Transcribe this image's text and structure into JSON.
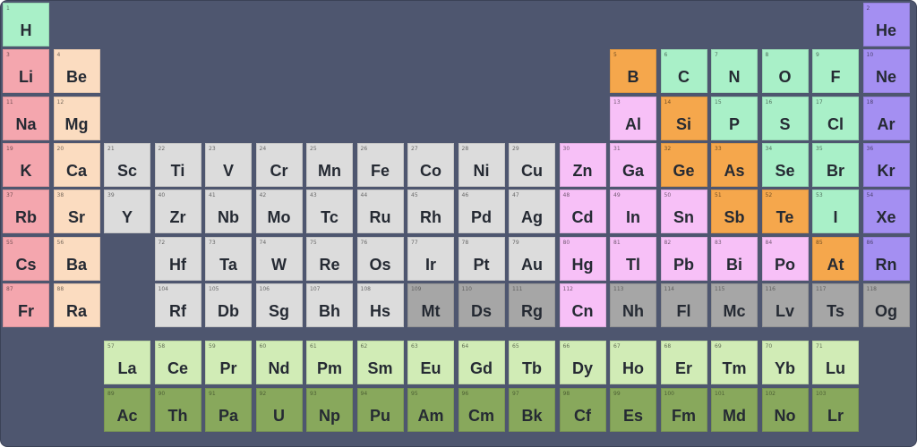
{
  "colors": {
    "background": "#4e566f",
    "hydrogen_nonmetal": "#a9f0c8",
    "alkali": "#f4a6ae",
    "alkaline": "#fbdcc0",
    "transition": "#dcdcdc",
    "post_transition": "#f7c0f7",
    "metalloid": "#f5a74c",
    "noble": "#a48ff2",
    "unknown": "#a6a6a6",
    "lanthanide": "#d1ecb6",
    "actinide": "#88a85c"
  },
  "elements": [
    {
      "symbol": "H",
      "number": "1",
      "row": 0,
      "col": 0,
      "cat": "hydrogen_nonmetal"
    },
    {
      "symbol": "He",
      "number": "2",
      "row": 0,
      "col": 17,
      "cat": "noble"
    },
    {
      "symbol": "Li",
      "number": "3",
      "row": 1,
      "col": 0,
      "cat": "alkali"
    },
    {
      "symbol": "Be",
      "number": "4",
      "row": 1,
      "col": 1,
      "cat": "alkaline"
    },
    {
      "symbol": "B",
      "number": "5",
      "row": 1,
      "col": 12,
      "cat": "metalloid"
    },
    {
      "symbol": "C",
      "number": "6",
      "row": 1,
      "col": 13,
      "cat": "hydrogen_nonmetal"
    },
    {
      "symbol": "N",
      "number": "7",
      "row": 1,
      "col": 14,
      "cat": "hydrogen_nonmetal"
    },
    {
      "symbol": "O",
      "number": "8",
      "row": 1,
      "col": 15,
      "cat": "hydrogen_nonmetal"
    },
    {
      "symbol": "F",
      "number": "9",
      "row": 1,
      "col": 16,
      "cat": "hydrogen_nonmetal"
    },
    {
      "symbol": "Ne",
      "number": "10",
      "row": 1,
      "col": 17,
      "cat": "noble"
    },
    {
      "symbol": "Na",
      "number": "11",
      "row": 2,
      "col": 0,
      "cat": "alkali"
    },
    {
      "symbol": "Mg",
      "number": "12",
      "row": 2,
      "col": 1,
      "cat": "alkaline"
    },
    {
      "symbol": "Al",
      "number": "13",
      "row": 2,
      "col": 12,
      "cat": "post_transition"
    },
    {
      "symbol": "Si",
      "number": "14",
      "row": 2,
      "col": 13,
      "cat": "metalloid"
    },
    {
      "symbol": "P",
      "number": "15",
      "row": 2,
      "col": 14,
      "cat": "hydrogen_nonmetal"
    },
    {
      "symbol": "S",
      "number": "16",
      "row": 2,
      "col": 15,
      "cat": "hydrogen_nonmetal"
    },
    {
      "symbol": "Cl",
      "number": "17",
      "row": 2,
      "col": 16,
      "cat": "hydrogen_nonmetal"
    },
    {
      "symbol": "Ar",
      "number": "18",
      "row": 2,
      "col": 17,
      "cat": "noble"
    },
    {
      "symbol": "K",
      "number": "19",
      "row": 3,
      "col": 0,
      "cat": "alkali"
    },
    {
      "symbol": "Ca",
      "number": "20",
      "row": 3,
      "col": 1,
      "cat": "alkaline"
    },
    {
      "symbol": "Sc",
      "number": "21",
      "row": 3,
      "col": 2,
      "cat": "transition"
    },
    {
      "symbol": "Ti",
      "number": "22",
      "row": 3,
      "col": 3,
      "cat": "transition"
    },
    {
      "symbol": "V",
      "number": "23",
      "row": 3,
      "col": 4,
      "cat": "transition"
    },
    {
      "symbol": "Cr",
      "number": "24",
      "row": 3,
      "col": 5,
      "cat": "transition"
    },
    {
      "symbol": "Mn",
      "number": "25",
      "row": 3,
      "col": 6,
      "cat": "transition"
    },
    {
      "symbol": "Fe",
      "number": "26",
      "row": 3,
      "col": 7,
      "cat": "transition"
    },
    {
      "symbol": "Co",
      "number": "27",
      "row": 3,
      "col": 8,
      "cat": "transition"
    },
    {
      "symbol": "Ni",
      "number": "28",
      "row": 3,
      "col": 9,
      "cat": "transition"
    },
    {
      "symbol": "Cu",
      "number": "29",
      "row": 3,
      "col": 10,
      "cat": "transition"
    },
    {
      "symbol": "Zn",
      "number": "30",
      "row": 3,
      "col": 11,
      "cat": "post_transition"
    },
    {
      "symbol": "Ga",
      "number": "31",
      "row": 3,
      "col": 12,
      "cat": "post_transition"
    },
    {
      "symbol": "Ge",
      "number": "32",
      "row": 3,
      "col": 13,
      "cat": "metalloid"
    },
    {
      "symbol": "As",
      "number": "33",
      "row": 3,
      "col": 14,
      "cat": "metalloid"
    },
    {
      "symbol": "Se",
      "number": "34",
      "row": 3,
      "col": 15,
      "cat": "hydrogen_nonmetal"
    },
    {
      "symbol": "Br",
      "number": "35",
      "row": 3,
      "col": 16,
      "cat": "hydrogen_nonmetal"
    },
    {
      "symbol": "Kr",
      "number": "36",
      "row": 3,
      "col": 17,
      "cat": "noble"
    },
    {
      "symbol": "Rb",
      "number": "37",
      "row": 4,
      "col": 0,
      "cat": "alkali"
    },
    {
      "symbol": "Sr",
      "number": "38",
      "row": 4,
      "col": 1,
      "cat": "alkaline"
    },
    {
      "symbol": "Y",
      "number": "39",
      "row": 4,
      "col": 2,
      "cat": "transition"
    },
    {
      "symbol": "Zr",
      "number": "40",
      "row": 4,
      "col": 3,
      "cat": "transition"
    },
    {
      "symbol": "Nb",
      "number": "41",
      "row": 4,
      "col": 4,
      "cat": "transition"
    },
    {
      "symbol": "Mo",
      "number": "42",
      "row": 4,
      "col": 5,
      "cat": "transition"
    },
    {
      "symbol": "Tc",
      "number": "43",
      "row": 4,
      "col": 6,
      "cat": "transition"
    },
    {
      "symbol": "Ru",
      "number": "44",
      "row": 4,
      "col": 7,
      "cat": "transition"
    },
    {
      "symbol": "Rh",
      "number": "45",
      "row": 4,
      "col": 8,
      "cat": "transition"
    },
    {
      "symbol": "Pd",
      "number": "46",
      "row": 4,
      "col": 9,
      "cat": "transition"
    },
    {
      "symbol": "Ag",
      "number": "47",
      "row": 4,
      "col": 10,
      "cat": "transition"
    },
    {
      "symbol": "Cd",
      "number": "48",
      "row": 4,
      "col": 11,
      "cat": "post_transition"
    },
    {
      "symbol": "In",
      "number": "49",
      "row": 4,
      "col": 12,
      "cat": "post_transition"
    },
    {
      "symbol": "Sn",
      "number": "50",
      "row": 4,
      "col": 13,
      "cat": "post_transition"
    },
    {
      "symbol": "Sb",
      "number": "51",
      "row": 4,
      "col": 14,
      "cat": "metalloid"
    },
    {
      "symbol": "Te",
      "number": "52",
      "row": 4,
      "col": 15,
      "cat": "metalloid"
    },
    {
      "symbol": "I",
      "number": "53",
      "row": 4,
      "col": 16,
      "cat": "hydrogen_nonmetal"
    },
    {
      "symbol": "Xe",
      "number": "54",
      "row": 4,
      "col": 17,
      "cat": "noble"
    },
    {
      "symbol": "Cs",
      "number": "55",
      "row": 5,
      "col": 0,
      "cat": "alkali"
    },
    {
      "symbol": "Ba",
      "number": "56",
      "row": 5,
      "col": 1,
      "cat": "alkaline"
    },
    {
      "symbol": "Hf",
      "number": "72",
      "row": 5,
      "col": 3,
      "cat": "transition"
    },
    {
      "symbol": "Ta",
      "number": "73",
      "row": 5,
      "col": 4,
      "cat": "transition"
    },
    {
      "symbol": "W",
      "number": "74",
      "row": 5,
      "col": 5,
      "cat": "transition"
    },
    {
      "symbol": "Re",
      "number": "75",
      "row": 5,
      "col": 6,
      "cat": "transition"
    },
    {
      "symbol": "Os",
      "number": "76",
      "row": 5,
      "col": 7,
      "cat": "transition"
    },
    {
      "symbol": "Ir",
      "number": "77",
      "row": 5,
      "col": 8,
      "cat": "transition"
    },
    {
      "symbol": "Pt",
      "number": "78",
      "row": 5,
      "col": 9,
      "cat": "transition"
    },
    {
      "symbol": "Au",
      "number": "79",
      "row": 5,
      "col": 10,
      "cat": "transition"
    },
    {
      "symbol": "Hg",
      "number": "80",
      "row": 5,
      "col": 11,
      "cat": "post_transition"
    },
    {
      "symbol": "Tl",
      "number": "81",
      "row": 5,
      "col": 12,
      "cat": "post_transition"
    },
    {
      "symbol": "Pb",
      "number": "82",
      "row": 5,
      "col": 13,
      "cat": "post_transition"
    },
    {
      "symbol": "Bi",
      "number": "83",
      "row": 5,
      "col": 14,
      "cat": "post_transition"
    },
    {
      "symbol": "Po",
      "number": "84",
      "row": 5,
      "col": 15,
      "cat": "post_transition"
    },
    {
      "symbol": "At",
      "number": "85",
      "row": 5,
      "col": 16,
      "cat": "metalloid"
    },
    {
      "symbol": "Rn",
      "number": "86",
      "row": 5,
      "col": 17,
      "cat": "noble"
    },
    {
      "symbol": "Fr",
      "number": "87",
      "row": 6,
      "col": 0,
      "cat": "alkali"
    },
    {
      "symbol": "Ra",
      "number": "88",
      "row": 6,
      "col": 1,
      "cat": "alkaline"
    },
    {
      "symbol": "Rf",
      "number": "104",
      "row": 6,
      "col": 3,
      "cat": "transition"
    },
    {
      "symbol": "Db",
      "number": "105",
      "row": 6,
      "col": 4,
      "cat": "transition"
    },
    {
      "symbol": "Sg",
      "number": "106",
      "row": 6,
      "col": 5,
      "cat": "transition"
    },
    {
      "symbol": "Bh",
      "number": "107",
      "row": 6,
      "col": 6,
      "cat": "transition"
    },
    {
      "symbol": "Hs",
      "number": "108",
      "row": 6,
      "col": 7,
      "cat": "transition"
    },
    {
      "symbol": "Mt",
      "number": "109",
      "row": 6,
      "col": 8,
      "cat": "unknown"
    },
    {
      "symbol": "Ds",
      "number": "110",
      "row": 6,
      "col": 9,
      "cat": "unknown"
    },
    {
      "symbol": "Rg",
      "number": "111",
      "row": 6,
      "col": 10,
      "cat": "unknown"
    },
    {
      "symbol": "Cn",
      "number": "112",
      "row": 6,
      "col": 11,
      "cat": "post_transition"
    },
    {
      "symbol": "Nh",
      "number": "113",
      "row": 6,
      "col": 12,
      "cat": "unknown"
    },
    {
      "symbol": "Fl",
      "number": "114",
      "row": 6,
      "col": 13,
      "cat": "unknown"
    },
    {
      "symbol": "Mc",
      "number": "115",
      "row": 6,
      "col": 14,
      "cat": "unknown"
    },
    {
      "symbol": "Lv",
      "number": "116",
      "row": 6,
      "col": 15,
      "cat": "unknown"
    },
    {
      "symbol": "Ts",
      "number": "117",
      "row": 6,
      "col": 16,
      "cat": "unknown"
    },
    {
      "symbol": "Og",
      "number": "118",
      "row": 6,
      "col": 17,
      "cat": "unknown"
    },
    {
      "symbol": "La",
      "number": "57",
      "row": 7,
      "col": 2,
      "cat": "lanthanide"
    },
    {
      "symbol": "Ce",
      "number": "58",
      "row": 7,
      "col": 3,
      "cat": "lanthanide"
    },
    {
      "symbol": "Pr",
      "number": "59",
      "row": 7,
      "col": 4,
      "cat": "lanthanide"
    },
    {
      "symbol": "Nd",
      "number": "60",
      "row": 7,
      "col": 5,
      "cat": "lanthanide"
    },
    {
      "symbol": "Pm",
      "number": "61",
      "row": 7,
      "col": 6,
      "cat": "lanthanide"
    },
    {
      "symbol": "Sm",
      "number": "62",
      "row": 7,
      "col": 7,
      "cat": "lanthanide"
    },
    {
      "symbol": "Eu",
      "number": "63",
      "row": 7,
      "col": 8,
      "cat": "lanthanide"
    },
    {
      "symbol": "Gd",
      "number": "64",
      "row": 7,
      "col": 9,
      "cat": "lanthanide"
    },
    {
      "symbol": "Tb",
      "number": "65",
      "row": 7,
      "col": 10,
      "cat": "lanthanide"
    },
    {
      "symbol": "Dy",
      "number": "66",
      "row": 7,
      "col": 11,
      "cat": "lanthanide"
    },
    {
      "symbol": "Ho",
      "number": "67",
      "row": 7,
      "col": 12,
      "cat": "lanthanide"
    },
    {
      "symbol": "Er",
      "number": "68",
      "row": 7,
      "col": 13,
      "cat": "lanthanide"
    },
    {
      "symbol": "Tm",
      "number": "69",
      "row": 7,
      "col": 14,
      "cat": "lanthanide"
    },
    {
      "symbol": "Yb",
      "number": "70",
      "row": 7,
      "col": 15,
      "cat": "lanthanide"
    },
    {
      "symbol": "Lu",
      "number": "71",
      "row": 7,
      "col": 16,
      "cat": "lanthanide"
    },
    {
      "symbol": "Ac",
      "number": "89",
      "row": 8,
      "col": 2,
      "cat": "actinide"
    },
    {
      "symbol": "Th",
      "number": "90",
      "row": 8,
      "col": 3,
      "cat": "actinide"
    },
    {
      "symbol": "Pa",
      "number": "91",
      "row": 8,
      "col": 4,
      "cat": "actinide"
    },
    {
      "symbol": "U",
      "number": "92",
      "row": 8,
      "col": 5,
      "cat": "actinide"
    },
    {
      "symbol": "Np",
      "number": "93",
      "row": 8,
      "col": 6,
      "cat": "actinide"
    },
    {
      "symbol": "Pu",
      "number": "94",
      "row": 8,
      "col": 7,
      "cat": "actinide"
    },
    {
      "symbol": "Am",
      "number": "95",
      "row": 8,
      "col": 8,
      "cat": "actinide"
    },
    {
      "symbol": "Cm",
      "number": "96",
      "row": 8,
      "col": 9,
      "cat": "actinide"
    },
    {
      "symbol": "Bk",
      "number": "97",
      "row": 8,
      "col": 10,
      "cat": "actinide"
    },
    {
      "symbol": "Cf",
      "number": "98",
      "row": 8,
      "col": 11,
      "cat": "actinide"
    },
    {
      "symbol": "Es",
      "number": "99",
      "row": 8,
      "col": 12,
      "cat": "actinide"
    },
    {
      "symbol": "Fm",
      "number": "100",
      "row": 8,
      "col": 13,
      "cat": "actinide"
    },
    {
      "symbol": "Md",
      "number": "101",
      "row": 8,
      "col": 14,
      "cat": "actinide"
    },
    {
      "symbol": "No",
      "number": "102",
      "row": 8,
      "col": 15,
      "cat": "actinide"
    },
    {
      "symbol": "Lr",
      "number": "103",
      "row": 8,
      "col": 16,
      "cat": "actinide"
    }
  ]
}
